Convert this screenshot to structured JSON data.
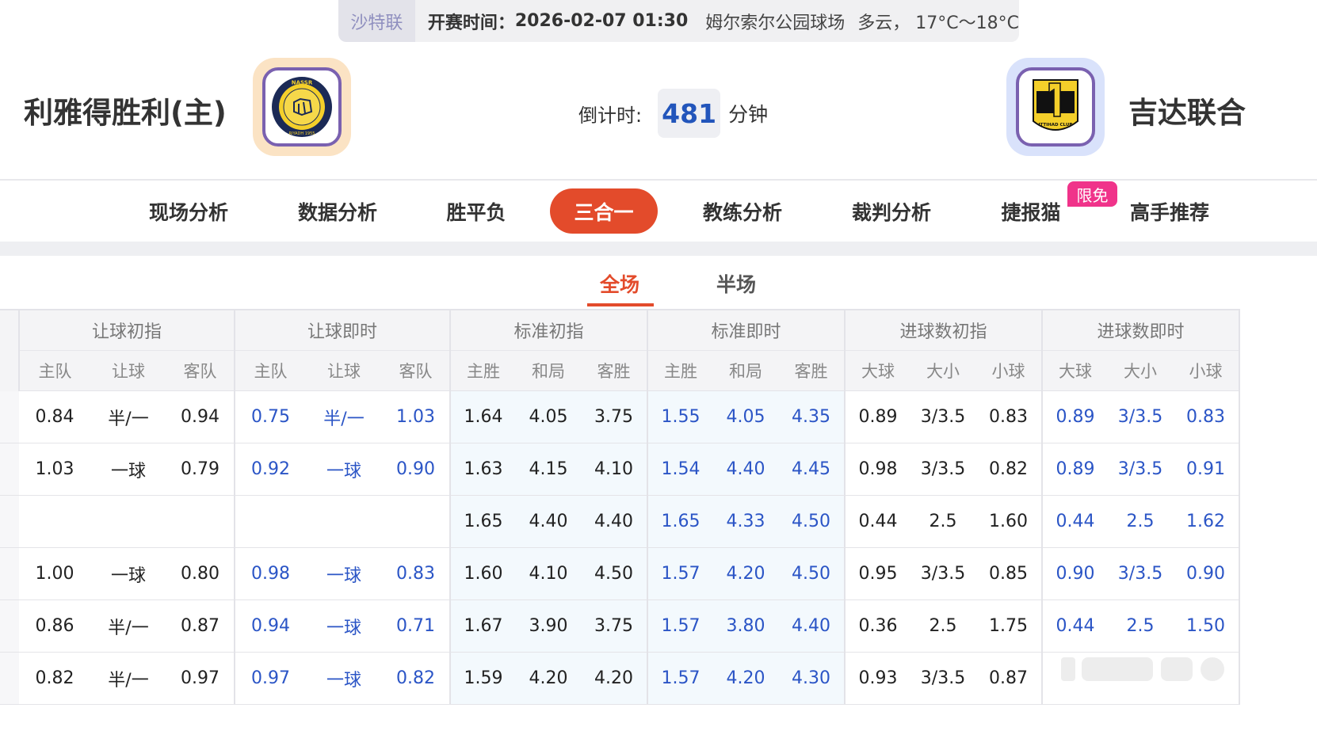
{
  "header": {
    "league": "沙特联",
    "kickoff_label": "开赛时间：",
    "kickoff_time": "2026-02-07 01:30",
    "venue": "姆尔索尔公园球场",
    "weather": "多云， 17°C～18°C"
  },
  "match": {
    "home_name": "利雅得胜利(主)",
    "away_name": "吉达联合",
    "countdown_label": "倒计时:",
    "countdown_value": "481",
    "countdown_unit": "分钟",
    "home_logo_text": "NASSR",
    "home_logo_sub": "RIYADH 1955",
    "away_logo_text": "ITTIHAD CLUB"
  },
  "nav": {
    "items": [
      "现场分析",
      "数据分析",
      "胜平负",
      "三合一",
      "教练分析",
      "裁判分析",
      "捷报猫",
      "高手推荐"
    ],
    "active": "三合一",
    "badge": "限免"
  },
  "subtabs": {
    "full": "全场",
    "half": "半场",
    "active": "全场"
  },
  "table": {
    "groups": [
      "让球初指",
      "让球即时",
      "标准初指",
      "标准即时",
      "进球数初指",
      "进球数即时"
    ],
    "columns": [
      "主队",
      "让球",
      "客队",
      "主队",
      "让球",
      "客队",
      "主胜",
      "和局",
      "客胜",
      "主胜",
      "和局",
      "客胜",
      "大球",
      "大小",
      "小球",
      "大球",
      "大小",
      "小球"
    ],
    "rows": [
      [
        "0.84",
        "半/一",
        "0.94",
        "0.75",
        "半/一",
        "1.03",
        "1.64",
        "4.05",
        "3.75",
        "1.55",
        "4.05",
        "4.35",
        "0.89",
        "3/3.5",
        "0.83",
        "0.89",
        "3/3.5",
        "0.83"
      ],
      [
        "1.03",
        "一球",
        "0.79",
        "0.92",
        "一球",
        "0.90",
        "1.63",
        "4.15",
        "4.10",
        "1.54",
        "4.40",
        "4.45",
        "0.98",
        "3/3.5",
        "0.82",
        "0.89",
        "3/3.5",
        "0.91"
      ],
      [
        "",
        "",
        "",
        "",
        "",
        "",
        "1.65",
        "4.40",
        "4.40",
        "1.65",
        "4.33",
        "4.50",
        "0.44",
        "2.5",
        "1.60",
        "0.44",
        "2.5",
        "1.62"
      ],
      [
        "1.00",
        "一球",
        "0.80",
        "0.98",
        "一球",
        "0.83",
        "1.60",
        "4.10",
        "4.50",
        "1.57",
        "4.20",
        "4.50",
        "0.95",
        "3/3.5",
        "0.85",
        "0.90",
        "3/3.5",
        "0.90"
      ],
      [
        "0.86",
        "半/一",
        "0.87",
        "0.94",
        "一球",
        "0.71",
        "1.67",
        "3.90",
        "3.75",
        "1.57",
        "3.80",
        "4.40",
        "0.36",
        "2.5",
        "1.75",
        "0.44",
        "2.5",
        "1.50"
      ],
      [
        "0.82",
        "半/一",
        "0.97",
        "0.97",
        "一球",
        "0.82",
        "1.59",
        "4.20",
        "4.20",
        "1.57",
        "4.20",
        "4.30",
        "0.93",
        "3/3.5",
        "0.87",
        "",
        "",
        ""
      ]
    ]
  },
  "colors": {
    "accent": "#e34b2b",
    "live_blue": "#2b55c6",
    "badge": "#f0338a"
  }
}
